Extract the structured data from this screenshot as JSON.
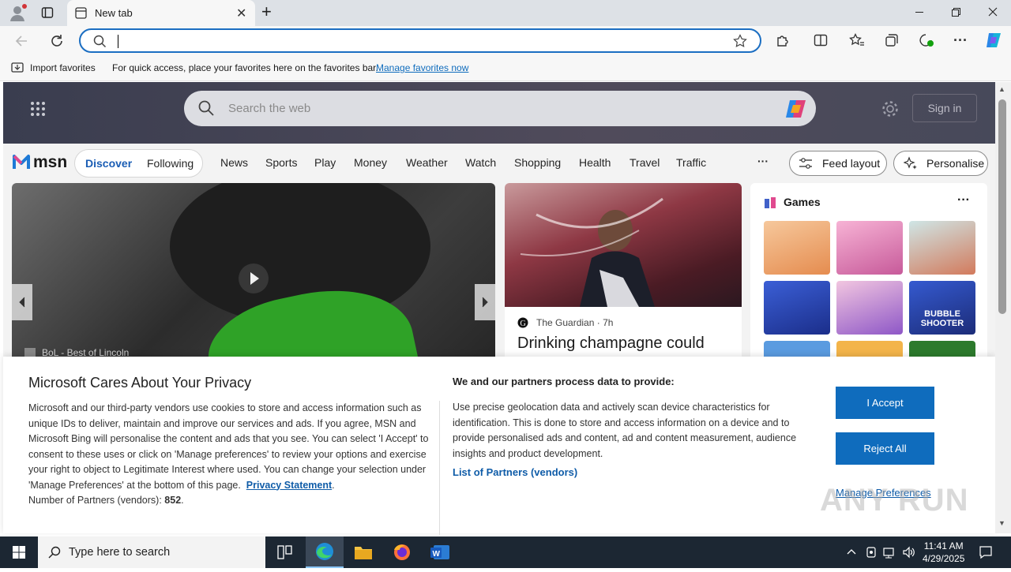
{
  "browser": {
    "tab_title": "New tab",
    "address_value": "",
    "favorites_bar": {
      "import_label": "Import favorites",
      "message": "For quick access, place your favorites here on the favorites bar.",
      "manage_link": "Manage favorites now"
    }
  },
  "msn": {
    "search_placeholder": "Search the web",
    "sign_in": "Sign in",
    "logo_text": "msn",
    "feed_tabs": [
      "Discover",
      "Following"
    ],
    "nav_items": [
      "News",
      "Sports",
      "Play",
      "Money",
      "Weather",
      "Watch",
      "Shopping",
      "Health",
      "Travel",
      "Traffic"
    ],
    "more": "···",
    "feed_layout": "Feed layout",
    "personalise": "Personalise",
    "carousel_source": "BoL - Best of Lincoln",
    "card": {
      "source": "The Guardian",
      "age": "7h",
      "headline": "Drinking champagne could"
    },
    "games": {
      "title": "Games",
      "more": "···",
      "bubble_tile_text": "BUBBLE SHOOTER"
    }
  },
  "privacy": {
    "title": "Microsoft Cares About Your Privacy",
    "body": "Microsoft and our third-party vendors use cookies to store and access information such as unique IDs to deliver, maintain and improve our services and ads. If you agree, MSN and Microsoft Bing will personalise the content and ads that you see. You can select 'I Accept' to consent to these uses or click on 'Manage preferences' to review your options and exercise your right to object to Legitimate Interest where used.  You can change your selection under 'Manage Preferences' at the bottom of this page.",
    "privacy_link": "Privacy Statement",
    "partners_count_label": "Number of Partners (vendors):",
    "partners_count": "852",
    "right_title": "We and our partners process data to provide:",
    "right_body": "Use precise geolocation data and actively scan device characteristics for identification. This is done to store and access information on a device and to provide personalised ads and content, ad and content measurement, audience insights and product development.",
    "partners_link": "List of Partners (vendors)",
    "accept": "I Accept",
    "reject": "Reject All",
    "manage": "Manage Preferences"
  },
  "watermark": "ANY RUN",
  "taskbar": {
    "search_placeholder": "Type here to search",
    "time": "11:41 AM",
    "date": "4/29/2025"
  },
  "colors": {
    "accent": "#0f6cbd",
    "taskbar": "#1c2733",
    "msn_header": "#45475a"
  }
}
